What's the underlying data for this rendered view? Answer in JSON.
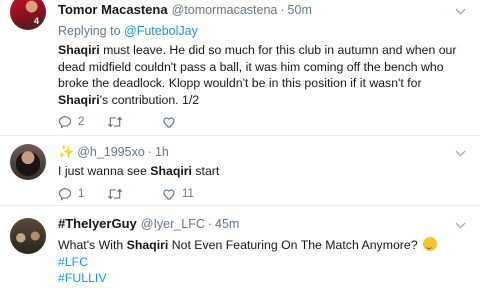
{
  "tweets": [
    {
      "display_name": "Tomor Macastena",
      "handle": "@tomormacastena",
      "time": "50m",
      "reply_prefix": "Replying to",
      "reply_handle": "@FutebolJay",
      "avatar_number": "4",
      "body": {
        "p1": "Shaqiri",
        "p2": " must leave. He did so much for this club in autumn and when our dead midfield couldn't pass a ball, it was him coming off the bench who broke the deadlock. Klopp wouldn't be in this position if it wasn't for ",
        "p3": "Shaqiri",
        "p4": "'s contribution. 1/2"
      },
      "reply_count": "2",
      "retweet_count": "",
      "like_count": ""
    },
    {
      "display_name": "",
      "handle": "@h_1995xo",
      "time": "1h",
      "body": {
        "p1": "I just wanna see ",
        "p2": "Shaqiri",
        "p3": " start"
      },
      "reply_count": "1",
      "retweet_count": "",
      "like_count": "11"
    },
    {
      "display_name": "#TheIyerGuy",
      "handle": "@Iyer_LFC",
      "time": "45m",
      "body": {
        "p1": "What's With ",
        "p2": "Shaqiri",
        "p3": " Not Even Featuring On The Match Anymore? ",
        "hashtag1": "#LFC",
        "hashtag2": "#FULLIV"
      },
      "reply_count": "",
      "retweet_count": "",
      "like_count": ""
    }
  ],
  "separator_dot": "·",
  "colors": {
    "link": "#1b95e0",
    "muted": "#657786",
    "border": "#e6ecf0"
  }
}
